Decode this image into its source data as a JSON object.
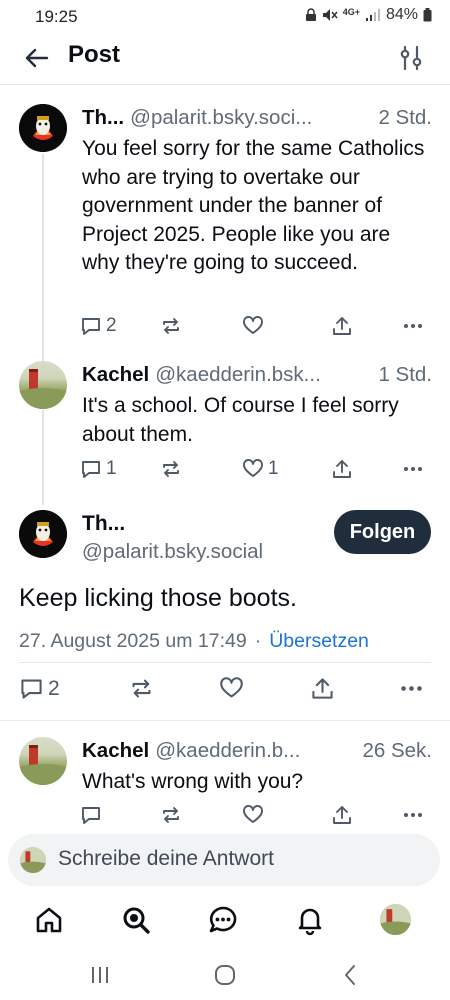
{
  "status_bar": {
    "time": "19:25",
    "battery": "84%",
    "network": "4G+"
  },
  "header": {
    "title": "Post"
  },
  "thread": [
    {
      "name": "Th...",
      "handle": "@palarit.bsky.soci...",
      "time": "2 Std.",
      "text": "You feel sorry for the same Catholics who are trying to overtake our government under the banner of Project 2025. People like you are why they're going to succeed.",
      "replies": "2",
      "likes": ""
    },
    {
      "name": "Kachel",
      "handle": "@kaedderin.bsk...",
      "time": "1 Std.",
      "text": "It's a school. Of course I feel sorry about them.",
      "replies": "1",
      "likes": "1"
    }
  ],
  "focus_post": {
    "name": "Th...",
    "handle": "@palarit.bsky.social",
    "follow_label": "Folgen",
    "text": "Keep licking those boots.",
    "date": "27. August 2025 um 17:49",
    "separator": "·",
    "translate_label": "Übersetzen",
    "replies": "2"
  },
  "reply": {
    "name": "Kachel",
    "handle": "@kaedderin.b...",
    "time": "26 Sek.",
    "text": "What's wrong with you?"
  },
  "composer": {
    "placeholder": "Schreibe deine Antwort"
  },
  "colors": {
    "accent": "#1a73d9",
    "follow_button": "#1f2d3d",
    "muted": "#5f6b78"
  },
  "nav_icons": [
    "home-icon",
    "search-icon",
    "chat-icon",
    "bell-icon",
    "profile-avatar"
  ]
}
